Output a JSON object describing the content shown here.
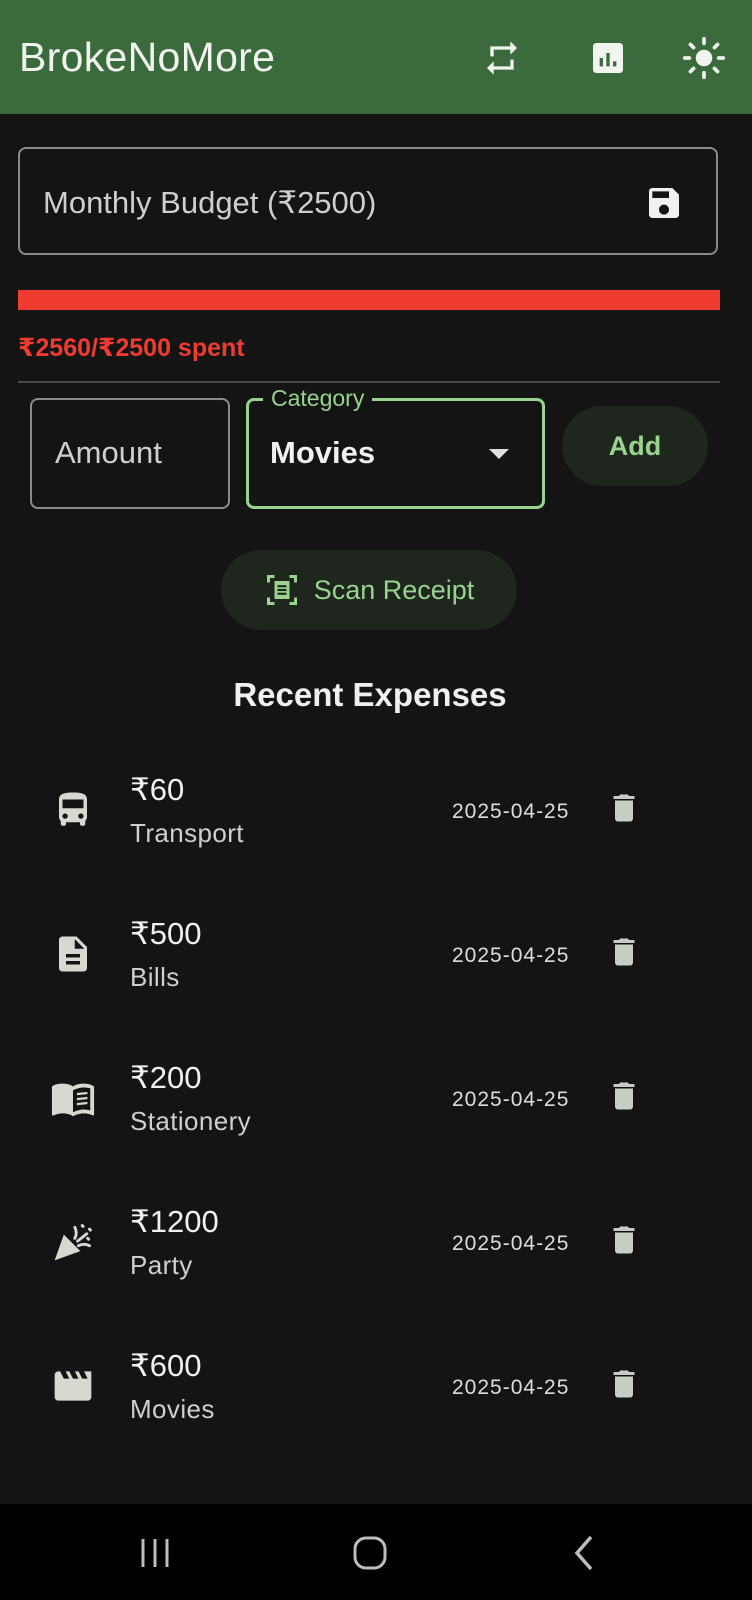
{
  "app": {
    "title": "BrokeNoMore"
  },
  "appbar_icons": [
    "swap-icon",
    "bar-chart-icon",
    "light-mode-icon"
  ],
  "budget": {
    "placeholder": "Monthly Budget (₹2500)",
    "spent_text": "₹2560/₹2500 spent",
    "progress_fraction": 1.0,
    "progress_color": "#ef3b30"
  },
  "form": {
    "amount_placeholder": "Amount",
    "category_label": "Category",
    "category_value": "Movies",
    "add_label": "Add",
    "scan_label": "Scan Receipt"
  },
  "expenses_title": "Recent Expenses",
  "expenses": [
    {
      "amount": "₹60",
      "category": "Transport",
      "date": "2025-04-25",
      "icon": "bus-icon"
    },
    {
      "amount": "₹500",
      "category": "Bills",
      "date": "2025-04-25",
      "icon": "document-icon"
    },
    {
      "amount": "₹200",
      "category": "Stationery",
      "date": "2025-04-25",
      "icon": "book-icon"
    },
    {
      "amount": "₹1200",
      "category": "Party",
      "date": "2025-04-25",
      "icon": "party-popper-icon"
    },
    {
      "amount": "₹600",
      "category": "Movies",
      "date": "2025-04-25",
      "icon": "clapperboard-icon"
    }
  ],
  "colors": {
    "appbar": "#3b6a3c",
    "accent": "#98d48e",
    "over_budget": "#ef3b30",
    "background": "#141414"
  }
}
